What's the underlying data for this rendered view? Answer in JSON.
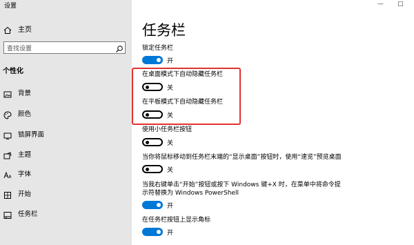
{
  "window": {
    "title": "设置",
    "minimize": "—",
    "maximize": "□"
  },
  "sidebar": {
    "home": "主页",
    "search_placeholder": "查找设置",
    "section": "个性化",
    "items": [
      {
        "label": "背景",
        "icon": "image-icon"
      },
      {
        "label": "颜色",
        "icon": "palette-icon"
      },
      {
        "label": "锁屏界面",
        "icon": "lock-screen-icon"
      },
      {
        "label": "主题",
        "icon": "theme-icon"
      },
      {
        "label": "字体",
        "icon": "font-icon"
      },
      {
        "label": "开始",
        "icon": "start-icon"
      },
      {
        "label": "任务栏",
        "icon": "taskbar-icon"
      }
    ]
  },
  "main": {
    "title": "任务栏",
    "settings": [
      {
        "label": "锁定任务栏",
        "on": true,
        "state": "开"
      },
      {
        "label": "在桌面模式下自动隐藏任务栏",
        "on": false,
        "state": "关"
      },
      {
        "label": "在平板模式下自动隐藏任务栏",
        "on": false,
        "state": "关"
      },
      {
        "label": "使用小任务栏按钮",
        "on": false,
        "state": "关"
      },
      {
        "label": "当你将鼠标移动到任务栏末端的“显示桌面”按钮时，使用“速览”预览桌面",
        "on": false,
        "state": "关"
      },
      {
        "label_lines": [
          "当我右键单击“开始”按钮或按下 Windows 键+X 时，在菜单中将命令提",
          "示符替换为 Windows PowerShell"
        ],
        "on": true,
        "state": "开"
      },
      {
        "label": "在任务栏按钮上显示角标",
        "on": true,
        "state": "开"
      }
    ]
  },
  "colors": {
    "accent": "#0078d7",
    "highlight": "#e03131",
    "sidebar_bg": "#e6e6e6"
  }
}
